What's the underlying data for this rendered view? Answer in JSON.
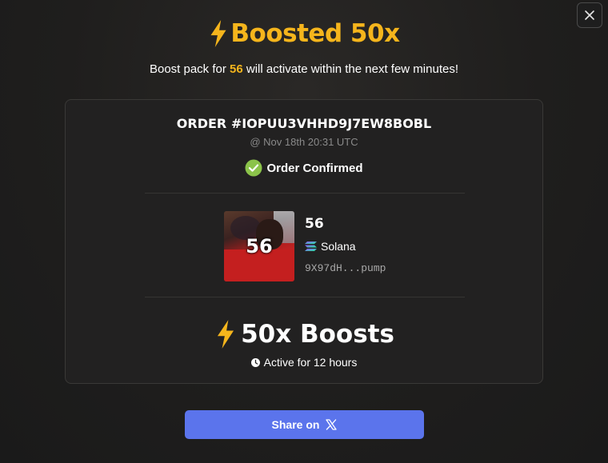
{
  "modal": {
    "title": "Boosted 50x",
    "subtitle_prefix": "Boost pack for ",
    "subtitle_token": "56",
    "subtitle_suffix": " will activate within the next few minutes!"
  },
  "order": {
    "id": "ORDER #IOPUU3VHHD9J7EW8BOBL",
    "date": "@ Nov 18th 20:31 UTC",
    "status": "Order Confirmed"
  },
  "token": {
    "image_label": "56",
    "name": "56",
    "chain": "Solana",
    "address": "9X97dH...pump"
  },
  "boost": {
    "label": "50x Boosts",
    "duration": "Active for 12 hours"
  },
  "share": {
    "label": "Share on"
  },
  "colors": {
    "accent": "#f5b51c",
    "confirm_green": "#8bc34a",
    "share_button": "#5b74ec"
  },
  "icons": [
    "close-icon",
    "lightning-icon",
    "check-circle-icon",
    "solana-icon",
    "clock-icon",
    "x-logo-icon"
  ]
}
